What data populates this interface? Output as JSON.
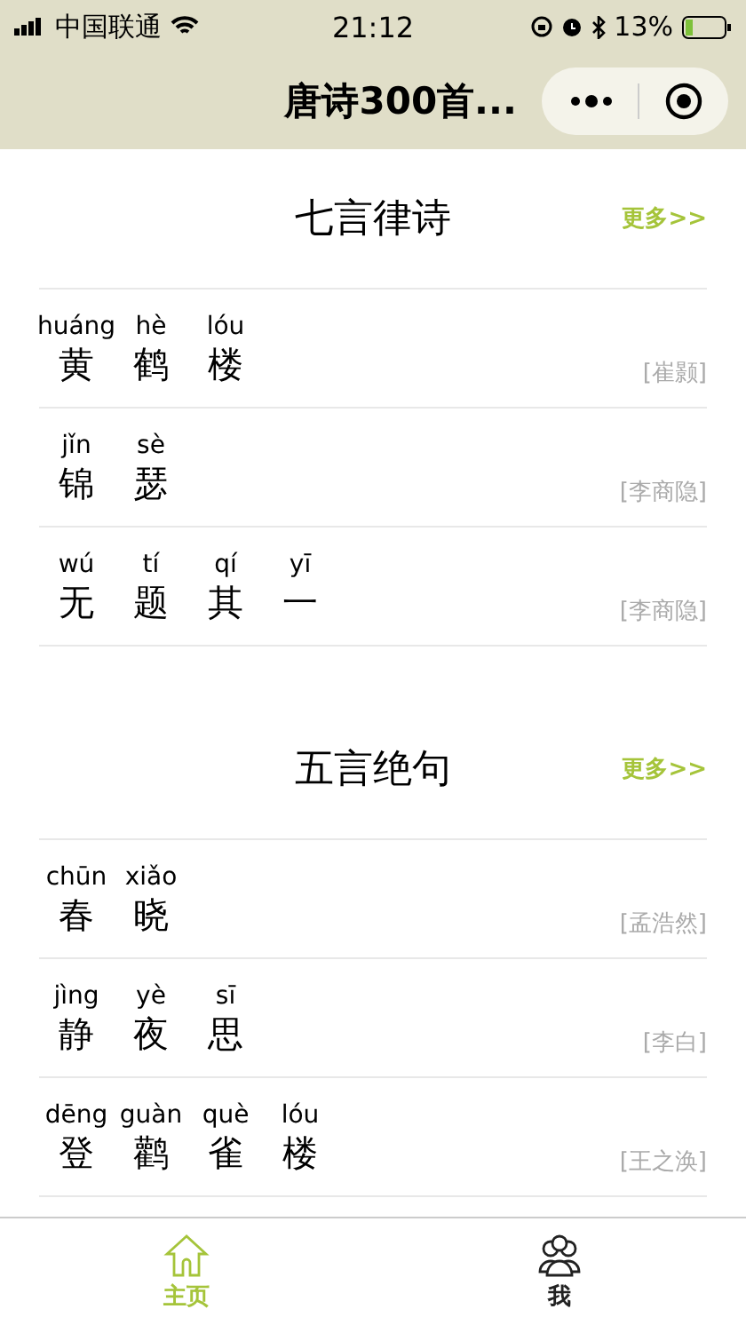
{
  "status_bar": {
    "carrier": "中国联通",
    "time": "21:12",
    "battery": "13%"
  },
  "nav_bar": {
    "title": "唐诗300首..."
  },
  "sections": [
    {
      "title": "七言律诗",
      "more": "更多>>",
      "poems": [
        {
          "chars": [
            {
              "pinyin": "huáng",
              "char": "黄"
            },
            {
              "pinyin": "hè",
              "char": "鹤"
            },
            {
              "pinyin": "lóu",
              "char": "楼"
            }
          ],
          "author": "[崔颢]"
        },
        {
          "chars": [
            {
              "pinyin": "jǐn",
              "char": "锦"
            },
            {
              "pinyin": "sè",
              "char": "瑟"
            }
          ],
          "author": "[李商隐]"
        },
        {
          "chars": [
            {
              "pinyin": "wú",
              "char": "无"
            },
            {
              "pinyin": "tí",
              "char": "题"
            },
            {
              "pinyin": "qí",
              "char": "其"
            },
            {
              "pinyin": "yī",
              "char": "一"
            }
          ],
          "author": "[李商隐]"
        }
      ]
    },
    {
      "title": "五言绝句",
      "more": "更多>>",
      "poems": [
        {
          "chars": [
            {
              "pinyin": "chūn",
              "char": "春"
            },
            {
              "pinyin": "xiǎo",
              "char": "晓"
            }
          ],
          "author": "[孟浩然]"
        },
        {
          "chars": [
            {
              "pinyin": "jìng",
              "char": "静"
            },
            {
              "pinyin": "yè",
              "char": "夜"
            },
            {
              "pinyin": "sī",
              "char": "思"
            }
          ],
          "author": "[李白]"
        },
        {
          "chars": [
            {
              "pinyin": "dēng",
              "char": "登"
            },
            {
              "pinyin": "guàn",
              "char": "鹳"
            },
            {
              "pinyin": "què",
              "char": "雀"
            },
            {
              "pinyin": "lóu",
              "char": "楼"
            }
          ],
          "author": "[王之涣]"
        }
      ]
    }
  ],
  "tab_bar": [
    {
      "label": "主页",
      "kind": "home",
      "selected": true
    },
    {
      "label": "我",
      "kind": "profile",
      "selected": false
    }
  ]
}
